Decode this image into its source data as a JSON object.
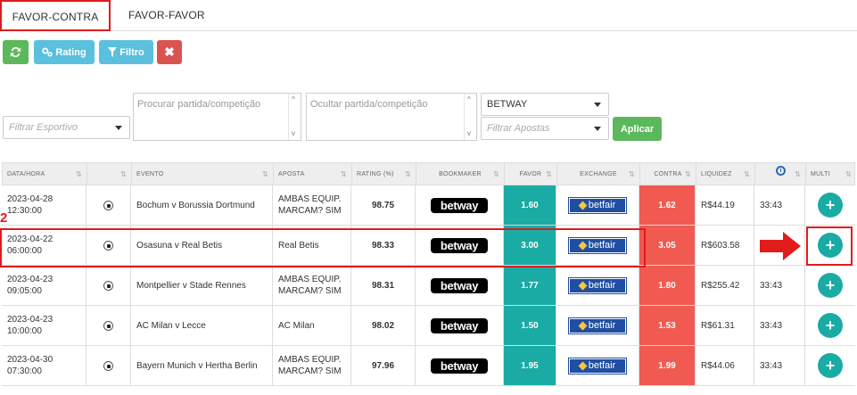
{
  "tabs": [
    {
      "label": "FAVOR-CONTRA",
      "active": true
    },
    {
      "label": "FAVOR-FAVOR",
      "active": false
    }
  ],
  "toolbar": {
    "rating_label": "Rating",
    "filtro_label": "Filtro",
    "refresh_icon": "refresh-icon",
    "clear_icon": "close-icon"
  },
  "filters": {
    "esportivo_placeholder": "Filtrar Esportivo",
    "procurar_placeholder": "Procurar partida/competição",
    "ocultar_placeholder": "Ocultar partida/competição",
    "bookmaker_value": "BETWAY",
    "apostas_placeholder": "Filtrar Apostas",
    "apply_label": "Aplicar"
  },
  "table": {
    "headers": {
      "data_hora": "DATA/HORA",
      "evento": "EVENTO",
      "aposta": "APOSTA",
      "rating": "RATING (%)",
      "bookmaker": "BOOKMAKER",
      "favor": "FAVOR",
      "exchange": "EXCHANGE",
      "contra": "CONTRA",
      "liquidez": "LIQUIDEZ",
      "multi": "MULTI"
    },
    "rows": [
      {
        "date": "2023-04-28",
        "time": "12:30:00",
        "evento": "Bochum v Borussia Dortmund",
        "aposta_1": "AMBAS EQUIP.",
        "aposta_2": "MARCAM? SIM",
        "rating": "98.75",
        "bookmaker": "betway",
        "favor": "1.60",
        "exchange": "betfair",
        "contra": "1.62",
        "liquidez": "R$44.19",
        "tempo": "33:43"
      },
      {
        "date": "2023-04-22",
        "time": "06:00:00",
        "evento": "Osasuna v Real Betis",
        "aposta_1": "Real Betis",
        "aposta_2": "",
        "rating": "98.33",
        "bookmaker": "betway",
        "favor": "3.00",
        "exchange": "betfair",
        "contra": "3.05",
        "liquidez": "R$603.58",
        "tempo": "33:43"
      },
      {
        "date": "2023-04-23",
        "time": "09:05:00",
        "evento": "Montpellier v Stade Rennes",
        "aposta_1": "AMBAS EQUIP.",
        "aposta_2": "MARCAM? SIM",
        "rating": "98.31",
        "bookmaker": "betway",
        "favor": "1.77",
        "exchange": "betfair",
        "contra": "1.80",
        "liquidez": "R$255.42",
        "tempo": "33:43"
      },
      {
        "date": "2023-04-23",
        "time": "10:00:00",
        "evento": "AC Milan v Lecce",
        "aposta_1": "AC Milan",
        "aposta_2": "",
        "rating": "98.02",
        "bookmaker": "betway",
        "favor": "1.50",
        "exchange": "betfair",
        "contra": "1.53",
        "liquidez": "R$61.31",
        "tempo": "33:43"
      },
      {
        "date": "2023-04-30",
        "time": "07:30:00",
        "evento": "Bayern Munich v Hertha Berlin",
        "aposta_1": "AMBAS EQUIP.",
        "aposta_2": "MARCAM? SIM",
        "rating": "97.96",
        "bookmaker": "betway",
        "favor": "1.95",
        "exchange": "betfair",
        "contra": "1.99",
        "liquidez": "R$44.06",
        "tempo": "33:43"
      }
    ]
  },
  "annotations": {
    "step_number": "2"
  },
  "colors": {
    "favor": "#1aaba5",
    "contra": "#f05a50",
    "highlight": "#e21b1b"
  }
}
